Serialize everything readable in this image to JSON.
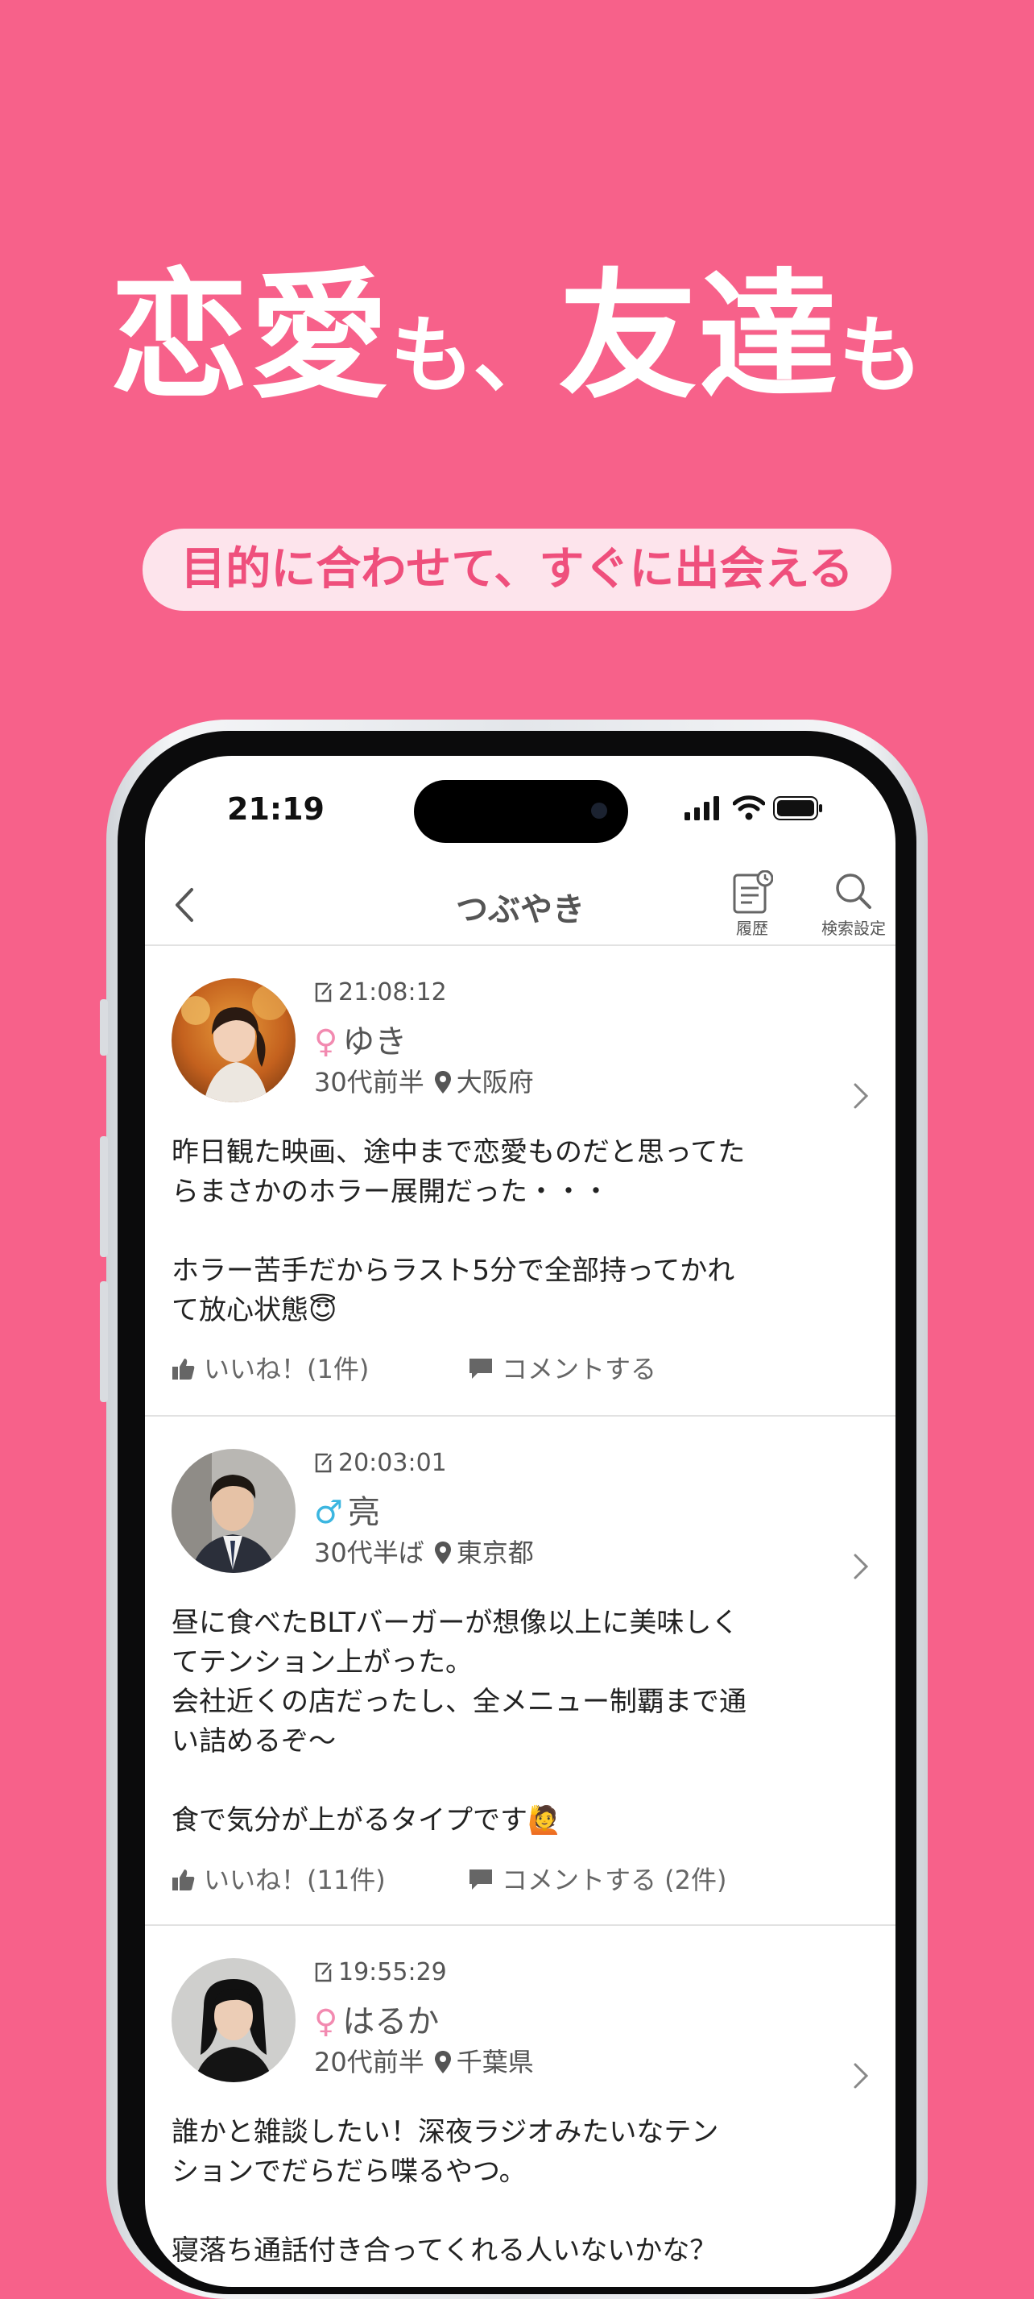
{
  "headline": {
    "part1": "恋愛",
    "part2": "も、",
    "part3": "友達",
    "part4": "も"
  },
  "subheadline": "目的に合わせて、すぐに出会える",
  "status_bar": {
    "time": "21:19"
  },
  "nav": {
    "title": "つぶやき",
    "history_label": "履歴",
    "search_label": "検索設定"
  },
  "posts": [
    {
      "time": "21:08:12",
      "gender_symbol": "♀",
      "gender": "female",
      "name": "ゆき",
      "age": "30代前半",
      "location": "大阪府",
      "text": "昨日観た映画、途中まで恋愛ものだと思ってた\nらまさかのホラー展開だった・・・\n\nホラー苦手だからラスト5分で全部持ってかれ\nて放心状態😇",
      "like_label": "いいね！(1件)",
      "comment_label": "コメントする"
    },
    {
      "time": "20:03:01",
      "gender_symbol": "♂",
      "gender": "male",
      "name": "亮",
      "age": "30代半ば",
      "location": "東京都",
      "text": "昼に食べたBLTバーガーが想像以上に美味しく\nてテンション上がった。\n会社近くの店だったし、全メニュー制覇まで通\nい詰めるぞ〜\n\n食で気分が上がるタイプです🙋",
      "like_label": "いいね！(11件)",
      "comment_label": "コメントする (2件)"
    },
    {
      "time": "19:55:29",
      "gender_symbol": "♀",
      "gender": "female",
      "name": "はるか",
      "age": "20代前半",
      "location": "千葉県",
      "text": "誰かと雑談したい！深夜ラジオみたいなテン\nションでだらだら喋るやつ。\n\n寝落ち通話付き合ってくれる人いないかな？"
    }
  ],
  "colors": {
    "background": "#f7618a",
    "female": "#f28ab0",
    "male": "#3cb6e0",
    "pill_text": "#ef4f7c"
  }
}
